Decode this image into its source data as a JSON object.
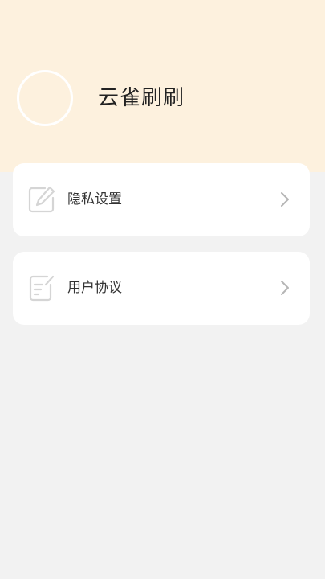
{
  "profile": {
    "app_name": "云雀刷刷"
  },
  "menu": {
    "items": [
      {
        "label": "隐私设置",
        "icon": "edit-icon"
      },
      {
        "label": "用户协议",
        "icon": "document-icon"
      }
    ]
  },
  "colors": {
    "header_bg": "#fdf1de",
    "page_bg": "#f2f2f2",
    "card_bg": "#ffffff",
    "icon_gray": "#d5d5d5",
    "chevron_gray": "#b5b5b5"
  }
}
